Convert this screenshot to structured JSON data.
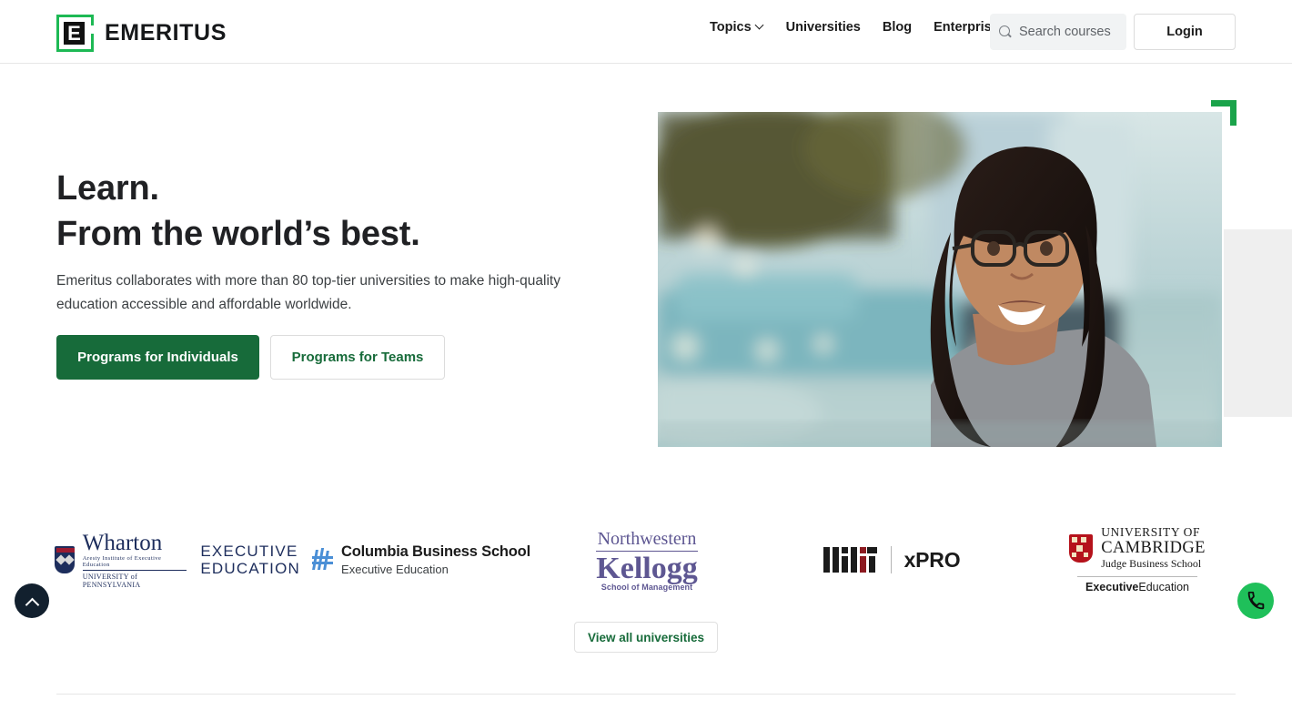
{
  "header": {
    "logo": {
      "mark_letter": "E",
      "brand": "EMERITUS"
    },
    "nav": [
      {
        "label": "Topics",
        "has_caret": true
      },
      {
        "label": "Universities",
        "has_caret": false
      },
      {
        "label": "Blog",
        "has_caret": false
      },
      {
        "label": "Enterprise",
        "has_caret": true
      }
    ],
    "search": {
      "placeholder": "Search courses",
      "value": "",
      "icon": "search-icon"
    },
    "login_label": "Login"
  },
  "hero": {
    "title_line1": "Learn.",
    "title_line2": "From the world’s best.",
    "subtitle": "Emeritus collaborates with more than 80 top-tier universities to make high-quality education accessible and affordable worldwide.",
    "primary_cta": "Programs for Individuals",
    "secondary_cta": "Programs for Teams",
    "image_alt": "Smiling woman with glasses on a city street"
  },
  "universities": [
    {
      "name": "Wharton Executive Education",
      "lines": {
        "wordmark": "Wharton",
        "institute": "Aresty Institute of Executive Education",
        "university": "UNIVERSITY of PENNSYLVANIA",
        "exec1": "EXECUTIVE",
        "exec2": "EDUCATION"
      }
    },
    {
      "name": "Columbia Business School Executive Education",
      "lines": {
        "school": "Columbia Business School",
        "program": "Executive Education"
      }
    },
    {
      "name": "Northwestern Kellogg School of Management",
      "lines": {
        "university": "Northwestern",
        "school": "Kellogg",
        "dept": "School of Management"
      }
    },
    {
      "name": "MIT xPRO",
      "lines": {
        "mark": "MIT",
        "program": "xPRO"
      }
    },
    {
      "name": "University of Cambridge Judge Business School",
      "lines": {
        "l1": "UNIVERSITY OF",
        "l2": "CAMBRIDGE",
        "l3": "Judge Business School",
        "exec_bold": "Executive",
        "exec_rest": "Education"
      }
    }
  ],
  "view_all_label": "View all universities",
  "floating": {
    "scroll_top": {
      "icon": "chevron-up-icon",
      "color": "#12202e"
    },
    "call": {
      "icon": "phone-icon",
      "color": "#1fc05a"
    }
  },
  "colors": {
    "brand_green": "#176b3a",
    "accent_green": "#1db954",
    "text_dark": "#202124",
    "search_bg": "#f1f3f4"
  }
}
